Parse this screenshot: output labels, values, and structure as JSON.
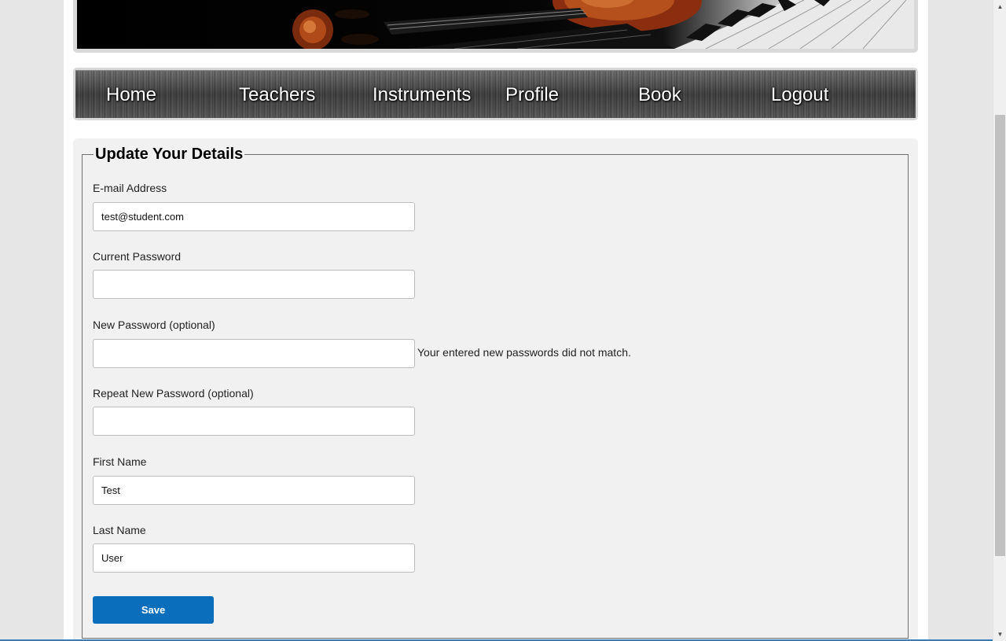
{
  "nav": {
    "items": [
      {
        "label": "Home"
      },
      {
        "label": "Teachers"
      },
      {
        "label": "Instruments"
      },
      {
        "label": "Profile"
      },
      {
        "label": "Book"
      },
      {
        "label": "Logout"
      }
    ]
  },
  "form": {
    "legend": "Update Your Details",
    "email": {
      "label": "E-mail Address",
      "value": "test@student.com"
    },
    "current_password": {
      "label": "Current Password",
      "value": ""
    },
    "new_password": {
      "label": "New Password (optional)",
      "value": "",
      "error": "Your entered new passwords did not match."
    },
    "repeat_password": {
      "label": "Repeat New Password (optional)",
      "value": ""
    },
    "first_name": {
      "label": "First Name",
      "value": "Test"
    },
    "last_name": {
      "label": "Last Name",
      "value": "User"
    },
    "save_label": "Save"
  },
  "colors": {
    "primary_button": "#0a6ebd",
    "content_bg": "#f1f1f1",
    "page_bg": "#e6e6e6"
  },
  "icons": {
    "scroll_up": "scroll-up-arrow-icon",
    "scroll_down": "scroll-down-arrow-icon"
  }
}
